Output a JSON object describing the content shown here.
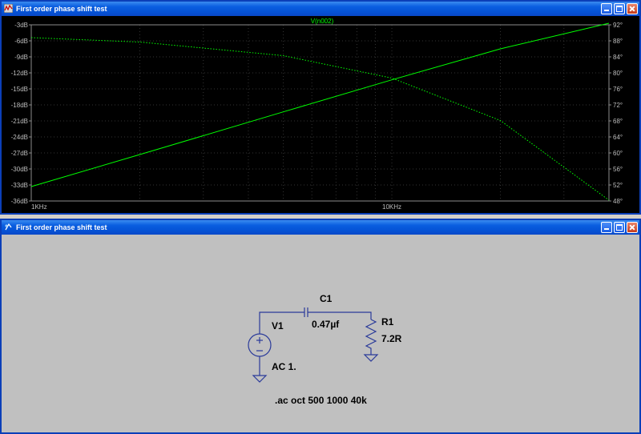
{
  "plot_window": {
    "title": "First order phase shift test",
    "trace_label": "V(n002)"
  },
  "schematic_window": {
    "title": "First order phase shift test",
    "components": {
      "c1_name": "C1",
      "c1_value": "0.47µf",
      "v1_name": "V1",
      "v1_value": "AC 1.",
      "r1_name": "R1",
      "r1_value": "7.2R"
    },
    "directive": ".ac oct 500 1000 40k"
  },
  "chart_data": {
    "type": "line",
    "x_scale": "log",
    "xlim": [
      1000,
      40000
    ],
    "x_ticks": [
      {
        "value": 1000,
        "label": "1KHz"
      },
      {
        "value": 10000,
        "label": "10KHz"
      }
    ],
    "y_left": {
      "ticks": [
        "-3dB",
        "-6dB",
        "-9dB",
        "-12dB",
        "-15dB",
        "-18dB",
        "-21dB",
        "-24dB",
        "-27dB",
        "-30dB",
        "-33dB",
        "-36dB"
      ],
      "range": [
        -36,
        -3
      ]
    },
    "y_right": {
      "ticks": [
        "92°",
        "88°",
        "84°",
        "80°",
        "76°",
        "72°",
        "68°",
        "64°",
        "60°",
        "56°",
        "52°",
        "48°"
      ],
      "range": [
        48,
        92
      ]
    },
    "series": [
      {
        "name": "V(n002)",
        "kind": "magnitude",
        "color": "#00ff00",
        "x": [
          1000,
          2000,
          5000,
          10000,
          20000,
          40000
        ],
        "y": [
          -33.3,
          -27.3,
          -19.3,
          -13.3,
          -7.5,
          -2.7
        ]
      },
      {
        "kind": "phase",
        "color": "#00ff00",
        "x": [
          1000,
          2000,
          5000,
          10000,
          20000,
          40000
        ],
        "y": [
          88.8,
          87.7,
          84.3,
          78.7,
          68.1,
          48.2
        ]
      }
    ],
    "grid": true
  }
}
